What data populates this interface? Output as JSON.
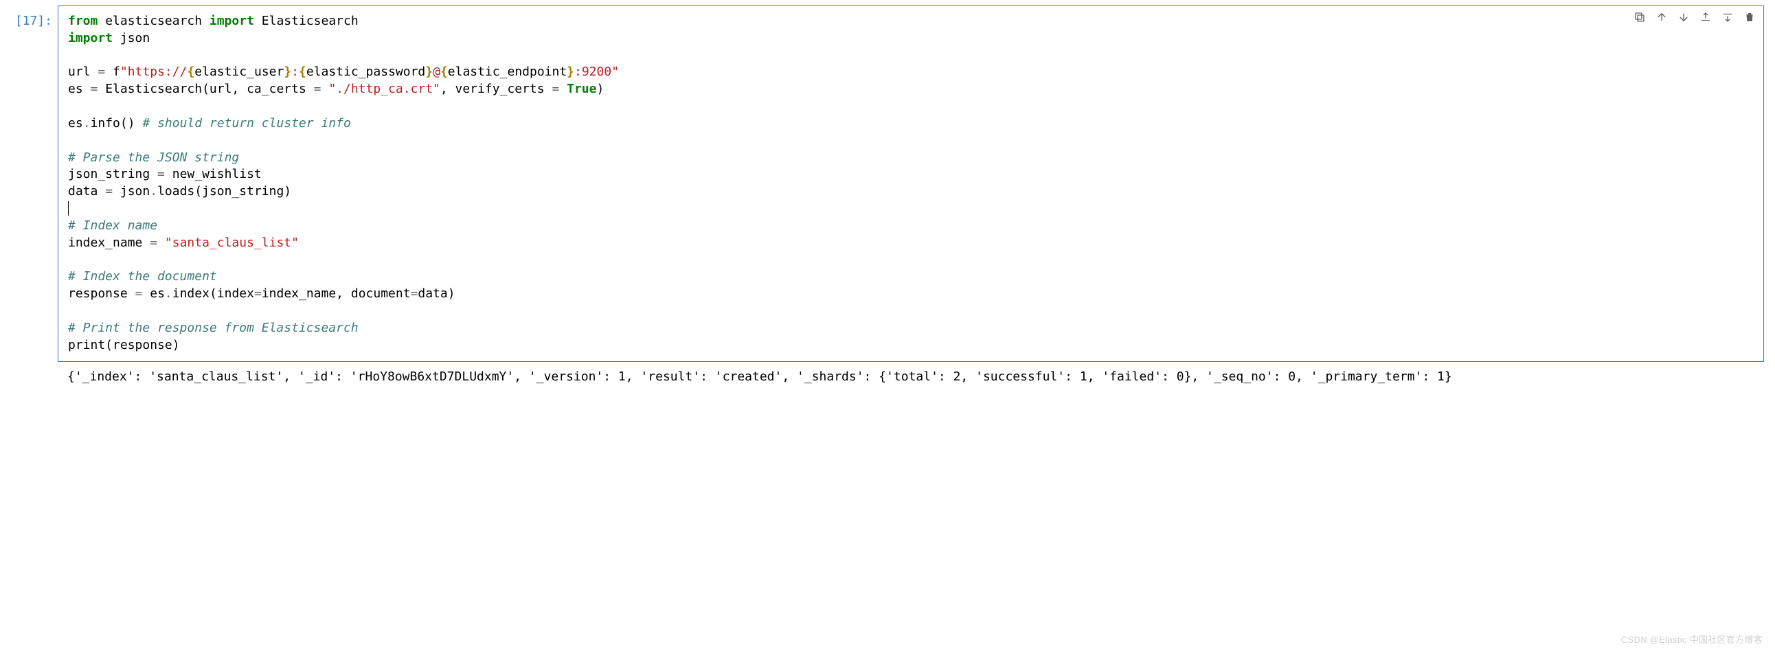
{
  "cell": {
    "prompt": "[17]:",
    "code": {
      "l1": {
        "kw1": "from",
        "mod": " elasticsearch ",
        "kw2": "import",
        "cls": " Elasticsearch"
      },
      "l2": {
        "kw": "import",
        "mod": " json"
      },
      "l4": {
        "lhs": "url ",
        "eq": "=",
        "pfx": " f",
        "q1": "\"",
        "s1": "https://",
        "b1": "{",
        "v1": "elastic_user",
        "b2": "}",
        "s2": ":",
        "b3": "{",
        "v2": "elastic_password",
        "b4": "}",
        "s3": "@",
        "b5": "{",
        "v3": "elastic_endpoint",
        "b6": "}",
        "s4": ":9200",
        "q2": "\""
      },
      "l5": {
        "lhs": "es ",
        "eq": "=",
        "rhs1": " Elasticsearch(url, ca_certs ",
        "eq2": "=",
        "str": " \"./http_ca.crt\"",
        "rhs2": ", verify_certs ",
        "eq3": "=",
        "true": " True",
        "rhs3": ")"
      },
      "l7": {
        "pre": "es",
        "dot": ".",
        "fn": "info",
        "post": "() ",
        "cm": "# should return cluster info"
      },
      "l9": {
        "cm": "# Parse the JSON string"
      },
      "l10": {
        "lhs": "json_string ",
        "eq": "=",
        "rhs": " new_wishlist"
      },
      "l11": {
        "lhs": "data ",
        "eq": "=",
        "rhs1": " json",
        "dot": ".",
        "fn": "loads",
        "rhs2": "(json_string)"
      },
      "l13": {
        "cm": "# Index name"
      },
      "l14": {
        "lhs": "index_name ",
        "eq": "=",
        "str": " \"santa_claus_list\""
      },
      "l16": {
        "cm": "# Index the document"
      },
      "l17": {
        "lhs": "response ",
        "eq": "=",
        "rhs1": " es",
        "dot": ".",
        "fn": "index",
        "rhs2": "(index",
        "eq2": "=",
        "rhs3": "index_name, document",
        "eq3": "=",
        "rhs4": "data)"
      },
      "l19": {
        "cm": "# Print the response from Elasticsearch"
      },
      "l20": {
        "txt": "print(response)"
      }
    },
    "output": "{'_index': 'santa_claus_list', '_id': 'rHoY8owB6xtD7DLUdxmY', '_version': 1, 'result': 'created', '_shards': {'total': 2, 'successful': 1, 'failed': 0}, '_seq_no': 0, '_primary_term': 1}"
  },
  "toolbar": {
    "icons": [
      "duplicate-icon",
      "move-up-icon",
      "move-down-icon",
      "insert-above-icon",
      "insert-below-icon",
      "delete-icon"
    ]
  },
  "watermark": "CSDN @Elastic 中国社区官方博客"
}
